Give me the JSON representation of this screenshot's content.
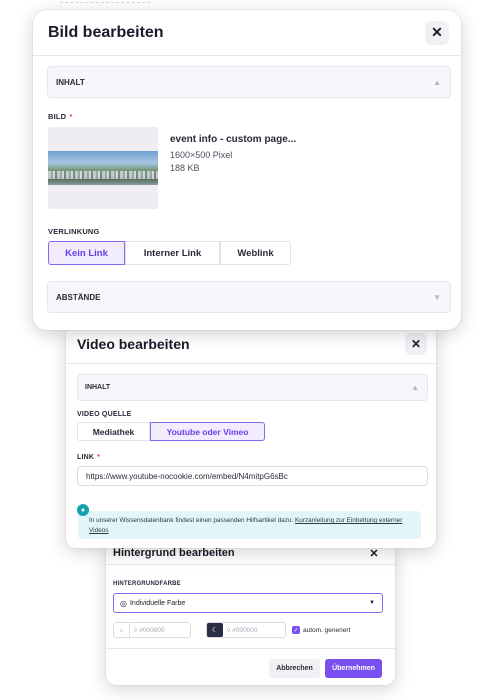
{
  "bild_modal": {
    "title": "Bild bearbeiten",
    "close_icon": "✕",
    "section_inhalt": "INHALT",
    "bild_label": "BILD",
    "required_marker": "*",
    "file_name": "event info - custom page...",
    "file_dimensions": "1600×500 Pixel",
    "file_size": "188 KB",
    "verlinkung_label": "VERLINKUNG",
    "link_options": [
      "Kein Link",
      "Interner Link",
      "Weblink"
    ],
    "link_selected": "Kein Link",
    "section_abstaende": "ABSTÄNDE"
  },
  "video_modal": {
    "title": "Video bearbeiten",
    "close_icon": "✕",
    "section_inhalt": "INHALT",
    "quelle_label": "VIDEO QUELLE",
    "source_options": [
      "Mediathek",
      "Youtube oder Vimeo"
    ],
    "source_selected": "Youtube oder Vimeo",
    "link_label": "LINK",
    "required_marker": "*",
    "link_value": "https://www.youtube-nocookie.com/embed/N4mitpG6sBc",
    "info_text": "In unserer Wissensdatenbank findest einen passenden Hilfsartikel dazu: ",
    "info_link_text": "Kurzanleitung zur Einbettung externer Videos"
  },
  "hintergrund_modal": {
    "title": "Hintergrund bearbeiten",
    "close_icon": "✕",
    "farbe_label": "HINTERGRUNDFARBE",
    "select_value": "Individuelle Farbe",
    "light_color_placeholder": "#000000",
    "dark_color_placeholder": "#000000",
    "auto_label": "autom. generiert",
    "auto_checked": true,
    "cancel_label": "Abbrechen",
    "ok_label": "Übernehmen"
  },
  "colors": {
    "accent": "#7a4ff0",
    "accent_bg": "#f1ecfe",
    "info_bg": "#e3f6f7",
    "required": "#e03a5b"
  }
}
